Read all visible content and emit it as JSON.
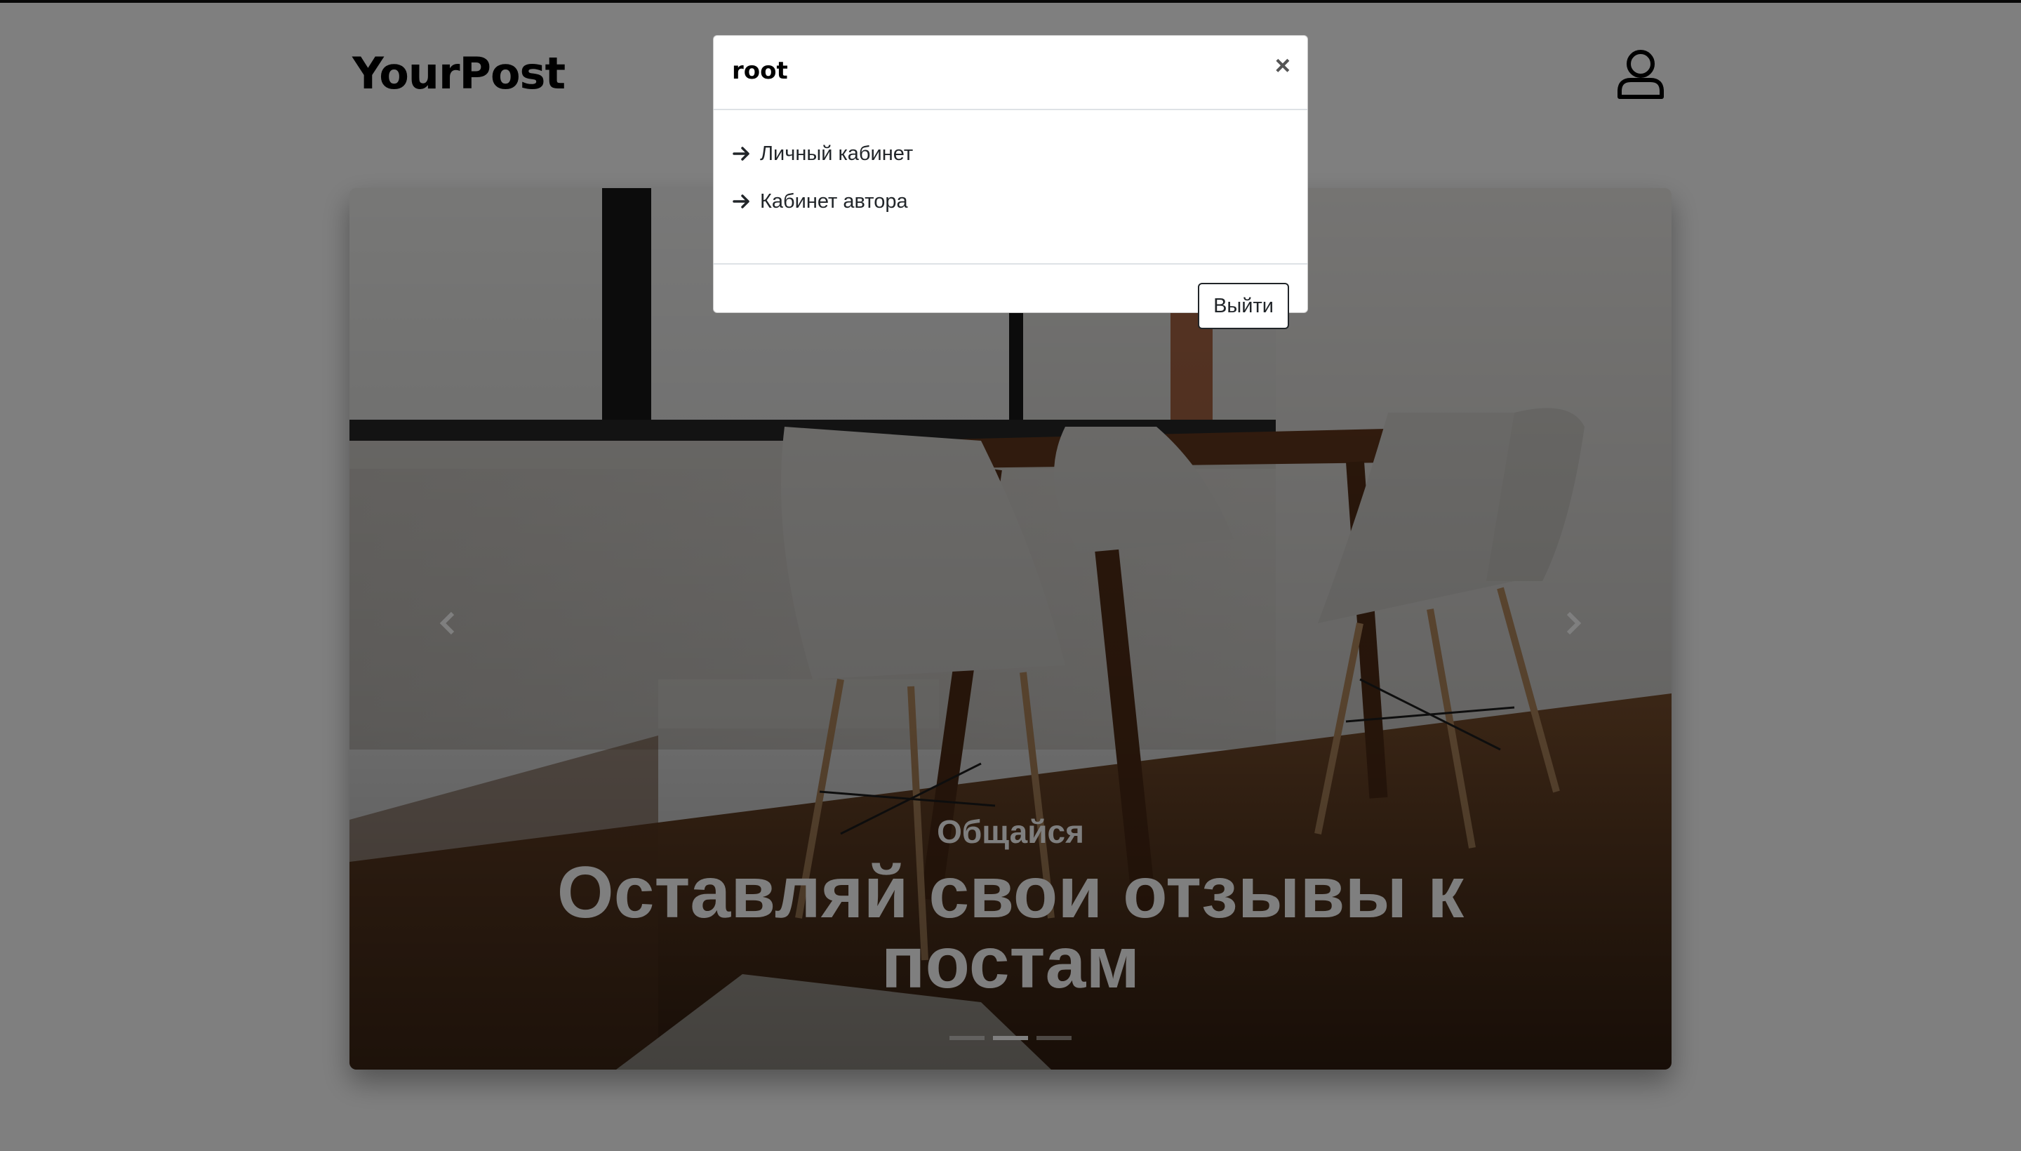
{
  "header": {
    "brand": "YourPost",
    "user_icon": "user-icon"
  },
  "carousel": {
    "slide_subtitle": "Общайся",
    "slide_title": "Оставляй свои отзывы к постам",
    "prev_icon": "chevron-left-icon",
    "next_icon": "chevron-right-icon",
    "indicator_count": 3,
    "active_indicator": 2
  },
  "modal": {
    "title": "root",
    "close_label": "×",
    "links": [
      {
        "label": "Личный кабинет",
        "icon": "arrow-right-icon"
      },
      {
        "label": "Кабинет автора",
        "icon": "arrow-right-icon"
      }
    ],
    "logout_label": "Выйти"
  },
  "colors": {
    "backdrop": "#000000",
    "backdrop_opacity": 0.5,
    "text_dark": "#212529",
    "caption": "#ffffff"
  }
}
